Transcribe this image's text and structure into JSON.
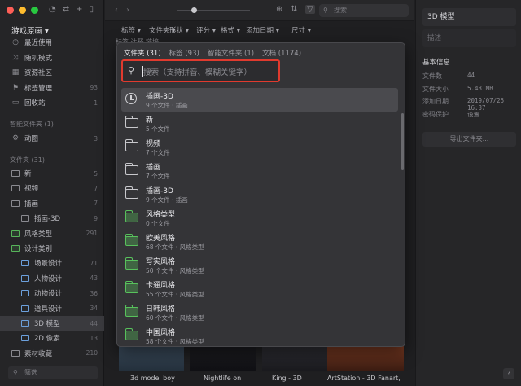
{
  "window": {
    "library_title": "游戏原画",
    "window_controls": [
      "close",
      "minimize",
      "zoom"
    ]
  },
  "sidebar": {
    "top_items": [
      {
        "label": "最近使用",
        "icon": "clock-icon",
        "count": ""
      },
      {
        "label": "随机模式",
        "icon": "shuffle-icon",
        "count": ""
      },
      {
        "label": "资源社区",
        "icon": "grid-icon",
        "count": ""
      },
      {
        "label": "标签管理",
        "icon": "tag-icon",
        "count": "93"
      },
      {
        "label": "回收站",
        "icon": "trash-icon",
        "count": "1"
      }
    ],
    "smart_header": "智能文件夹 (1)",
    "smart_items": [
      {
        "label": "动图",
        "count": "3"
      }
    ],
    "folders_header": "文件夹 (31)",
    "folders": [
      {
        "label": "新",
        "count": "5",
        "indent": 0,
        "color": "plain"
      },
      {
        "label": "视频",
        "count": "7",
        "indent": 0,
        "color": "plain"
      },
      {
        "label": "插画",
        "count": "7",
        "indent": 0,
        "color": "plain"
      },
      {
        "label": "插画-3D",
        "count": "9",
        "indent": 1,
        "color": "plain"
      },
      {
        "label": "风格类型",
        "count": "291",
        "indent": 0,
        "color": "green"
      },
      {
        "label": "设计类别",
        "count": "",
        "indent": 0,
        "color": "green"
      },
      {
        "label": "场景设计",
        "count": "71",
        "indent": 1,
        "color": "blue"
      },
      {
        "label": "人物设计",
        "count": "43",
        "indent": 1,
        "color": "blue"
      },
      {
        "label": "动物设计",
        "count": "36",
        "indent": 1,
        "color": "blue"
      },
      {
        "label": "道具设计",
        "count": "34",
        "indent": 1,
        "color": "blue"
      },
      {
        "label": "3D 模型",
        "count": "44",
        "indent": 1,
        "color": "blue",
        "selected": true
      },
      {
        "label": "2D 像素",
        "count": "13",
        "indent": 1,
        "color": "blue"
      },
      {
        "label": "素材收藏",
        "count": "210",
        "indent": 0,
        "color": "plain"
      }
    ],
    "filter_placeholder": "筛选"
  },
  "toolbar": {
    "search_placeholder": "搜索"
  },
  "filters": [
    "标签 ▾",
    "文件夹 ▾",
    "形状 ▾",
    "评分 ▾",
    "格式 ▾",
    "添加日期 ▾",
    "尺寸 ▾"
  ],
  "subtabs": "标签    注释    链接",
  "popup": {
    "tabs": [
      "文件夹 (31)",
      "标签 (93)",
      "智能文件夹 (1)",
      "文档 (1174)"
    ],
    "search_placeholder": "搜索（支持拼音、模糊关键字）",
    "items": [
      {
        "name": "插画-3D",
        "sub": "9 个文件 · 插画",
        "icon": "clock",
        "selected": true
      },
      {
        "name": "新",
        "sub": "5 个文件",
        "icon": "folder"
      },
      {
        "name": "视频",
        "sub": "7 个文件",
        "icon": "folder"
      },
      {
        "name": "插画",
        "sub": "7 个文件",
        "icon": "folder"
      },
      {
        "name": "插画-3D",
        "sub": "9 个文件 · 插画",
        "icon": "folder"
      },
      {
        "name": "风格类型",
        "sub": "0 个文件",
        "icon": "folder-green"
      },
      {
        "name": "欧美风格",
        "sub": "68 个文件 · 风格类型",
        "icon": "folder-green"
      },
      {
        "name": "写实风格",
        "sub": "50 个文件 · 风格类型",
        "icon": "folder-green"
      },
      {
        "name": "卡通风格",
        "sub": "55 个文件 · 风格类型",
        "icon": "folder-green"
      },
      {
        "name": "日韩风格",
        "sub": "60 个文件 · 风格类型",
        "icon": "folder-green"
      },
      {
        "name": "中国风格",
        "sub": "58 个文件 · 风格类型",
        "icon": "folder-green"
      }
    ]
  },
  "inspector": {
    "title": "3D 模型",
    "note_placeholder": "描述",
    "section": "基本信息",
    "rows": [
      {
        "key": "文件数",
        "value": "44"
      },
      {
        "key": "文件大小",
        "value": "5.43 MB"
      },
      {
        "key": "添加日期",
        "value": "2019/07/25 16:37"
      },
      {
        "key": "密码保护",
        "value": "设置"
      }
    ],
    "export_label": "导出文件夹..."
  },
  "gallery_captions": [
    "3d model boy",
    "Nightlife on",
    "King - 3D",
    "ArtStation - 3D Fanart,"
  ],
  "help_label": "?",
  "colors": {
    "highlight": "#e03a2e",
    "folder_green": "#58c25c",
    "folder_blue": "#6ca0dc"
  }
}
